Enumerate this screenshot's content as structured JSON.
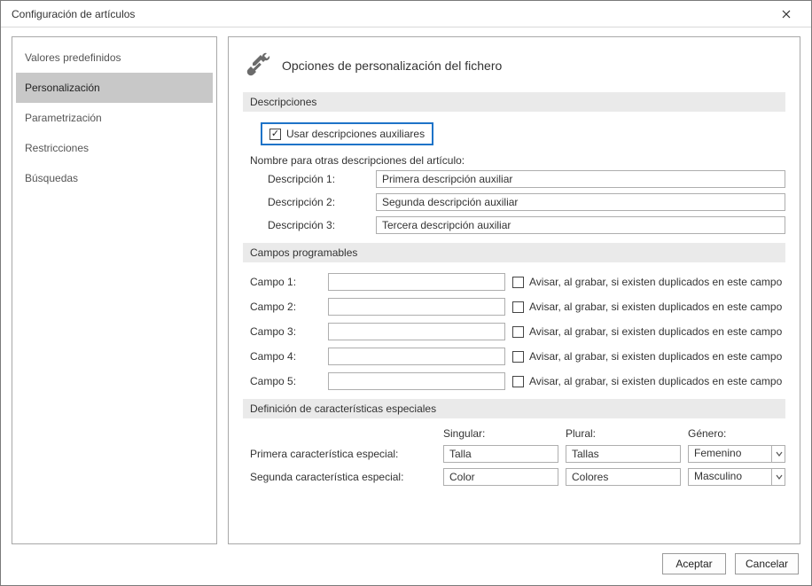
{
  "window": {
    "title": "Configuración de artículos"
  },
  "sidebar": {
    "items": [
      {
        "label": "Valores predefinidos",
        "selected": false
      },
      {
        "label": "Personalización",
        "selected": true
      },
      {
        "label": "Parametrización",
        "selected": false
      },
      {
        "label": "Restricciones",
        "selected": false
      },
      {
        "label": "Búsquedas",
        "selected": false
      }
    ]
  },
  "panel": {
    "heading": "Opciones de personalización del fichero",
    "descriptions": {
      "section_label": "Descripciones",
      "aux_checkbox_label": "Usar descripciones auxiliares",
      "aux_checked": true,
      "subheading": "Nombre para otras descripciones del artículo:",
      "rows": [
        {
          "label": "Descripción 1:",
          "value": "Primera descripción auxiliar"
        },
        {
          "label": "Descripción 2:",
          "value": "Segunda descripción auxiliar"
        },
        {
          "label": "Descripción 3:",
          "value": "Tercera descripción auxiliar"
        }
      ]
    },
    "campos": {
      "section_label": "Campos programables",
      "warn_label": "Avisar, al grabar, si existen duplicados en este campo",
      "rows": [
        {
          "label": "Campo 1:",
          "value": "",
          "warn": false
        },
        {
          "label": "Campo 2:",
          "value": "",
          "warn": false
        },
        {
          "label": "Campo 3:",
          "value": "",
          "warn": false
        },
        {
          "label": "Campo 4:",
          "value": "",
          "warn": false
        },
        {
          "label": "Campo 5:",
          "value": "",
          "warn": false
        }
      ]
    },
    "defs": {
      "section_label": "Definición de características especiales",
      "headers": {
        "singular": "Singular:",
        "plural": "Plural:",
        "genero": "Género:"
      },
      "rows": [
        {
          "label": "Primera característica especial:",
          "singular": "Talla",
          "plural": "Tallas",
          "genero": "Femenino"
        },
        {
          "label": "Segunda característica especial:",
          "singular": "Color",
          "plural": "Colores",
          "genero": "Masculino"
        }
      ]
    }
  },
  "footer": {
    "accept": "Aceptar",
    "cancel": "Cancelar"
  }
}
